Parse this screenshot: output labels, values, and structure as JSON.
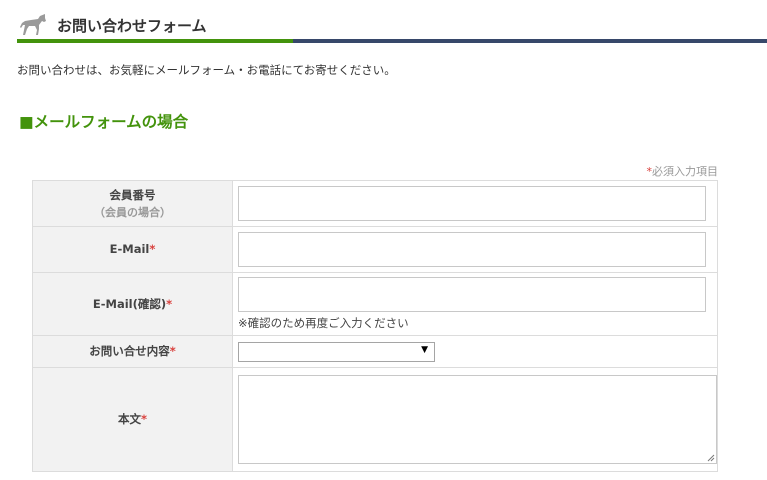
{
  "header": {
    "title": "お問い合わせフォーム",
    "icon": "horse-icon"
  },
  "colors": {
    "accent_green": "#43930c",
    "navy": "#37486a",
    "required_red": "#d9413d"
  },
  "intro_text": "お問い合わせは、お気軽にメールフォーム・お電話にてお寄せください。",
  "section": {
    "heading": "■メールフォームの場合"
  },
  "form": {
    "required_note": {
      "mark": "*",
      "text": "必須入力項目"
    },
    "rows": [
      {
        "label": "会員番号",
        "sublabel": "（会員の場合）",
        "value": ""
      },
      {
        "label": "E-Mail",
        "required": "*",
        "value": ""
      },
      {
        "label": "E-Mail(確認)",
        "required": "*",
        "value": "",
        "hint": "※確認のため再度ご入力ください"
      },
      {
        "label": "お問い合せ内容",
        "required": "*",
        "selected": "",
        "arrow": "▼"
      },
      {
        "label": "本文",
        "required": "*",
        "value": ""
      }
    ]
  }
}
